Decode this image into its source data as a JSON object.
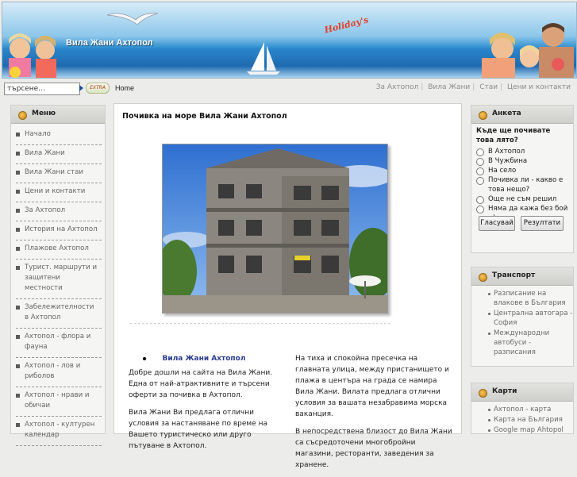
{
  "header": {
    "site_title": "Вила Жани Ахтопол",
    "holiday": "Holiday's"
  },
  "toolbar": {
    "search_value": "търсене...",
    "breadcrumb": "Home",
    "nav": [
      "За Ахтопол",
      "Вила Жани",
      "Стаи",
      "Цени и контакти"
    ]
  },
  "menu": {
    "title": "Меню",
    "items": [
      "Начало",
      "Вила Жани",
      "Вила Жани стаи",
      "Цени и контакти",
      "За Ахтопол",
      "История на Ахтопол",
      "Плажове Ахтопол",
      "Турист. маршрути и защитени местности",
      "Забележителности в Ахтопол",
      "Ахтопол - флора и фауна",
      "Ахтопол - лов и риболов",
      "Ахтопол - нрави и обичаи",
      "Ахтопол - културен календар"
    ]
  },
  "main": {
    "title": "Почивка на море Вила Жани Ахтопол",
    "villa_link": "Вила Жани Ахтопол",
    "left_p1": "Добре дошли на сайта на   Вила Жани. Една от най-атрактивните и търсени оферти за почивка в Ахтопол.",
    "left_p2": "Вила Жани Ви предлага отлични условия за настаняване по време на Вашето туристическо или друго пътуване в Ахтопол.",
    "right_p1": "На тиха и спокойна пресечка на главната улица, между пристанището и плажа в центъра на града се намира Вила Жани. Вилата предлага отлични условия за вашата незабравима морска ваканция.",
    "right_p2": "В непосредствена близост до Вила Жани са съсредоточени многобройни магазини, ресторанти, заведения за хранене."
  },
  "poll": {
    "title": "Анкета",
    "question": "Къде ще почивате това лято?",
    "options": [
      "В Ахтопол",
      "В Чужбина",
      "На село",
      "Почивка ли - какво е това нещо?",
      "Още не съм решил",
      "Няма да кажа без бой :-)"
    ],
    "vote_label": "Гласувай",
    "results_label": "Резултати"
  },
  "transport": {
    "title": "Транспорт",
    "links": [
      "Разписание на влаковe в България",
      "Централна автогара - София",
      "Международни автобуси - разписания"
    ]
  },
  "maps": {
    "title": "Карти",
    "links": [
      "Ахтопол - карта",
      "Карта на България",
      "Google map Ahtopol"
    ]
  }
}
